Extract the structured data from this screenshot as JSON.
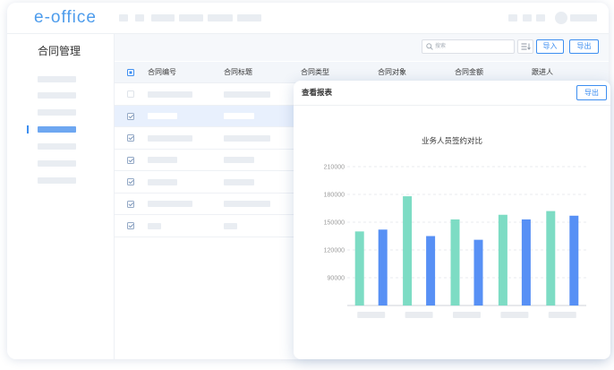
{
  "app": {
    "logo": "e-office"
  },
  "colors": {
    "logo": "#4d9cec",
    "accent": "#3d8ef0",
    "sidebar_active": "#6ea7f1",
    "selected_row": "#e8f0fd",
    "placeholder": "#e9edf2"
  },
  "topbar": {
    "avatar_icon": "avatar"
  },
  "sidebar": {
    "title": "合同管理",
    "active_index": 3
  },
  "toolbar": {
    "search_icon": "search-icon",
    "search_placeholder": "搜索",
    "filter_icon": "filter-icon",
    "import_label": "导入",
    "export_label": "导出"
  },
  "table": {
    "select_all_state": "indeterminate",
    "headers": [
      "合同编号",
      "合同标题",
      "合同类型",
      "合同对象",
      "合同金额",
      "跟进人"
    ],
    "rows": [
      {
        "checked": false,
        "selected": false
      },
      {
        "checked": true,
        "selected": true
      },
      {
        "checked": true,
        "selected": false
      },
      {
        "checked": true,
        "selected": false
      },
      {
        "checked": true,
        "selected": false
      },
      {
        "checked": true,
        "selected": false
      },
      {
        "checked": true,
        "selected": false
      }
    ]
  },
  "report_panel": {
    "title": "查看报表",
    "export_label": "导出"
  },
  "chart_data": {
    "type": "bar",
    "title": "业务人员签约对比",
    "ylim": [
      60000,
      210000
    ],
    "yticks": [
      210000,
      180000,
      150000,
      120000,
      90000
    ],
    "grid": true,
    "legend": "none",
    "series": [
      {
        "color": "#7ddcc4",
        "values": [
          140000,
          178000,
          153000,
          158000,
          162000
        ]
      },
      {
        "color": "#5790f5",
        "values": [
          142000,
          135000,
          131000,
          153000,
          157000
        ]
      }
    ]
  }
}
